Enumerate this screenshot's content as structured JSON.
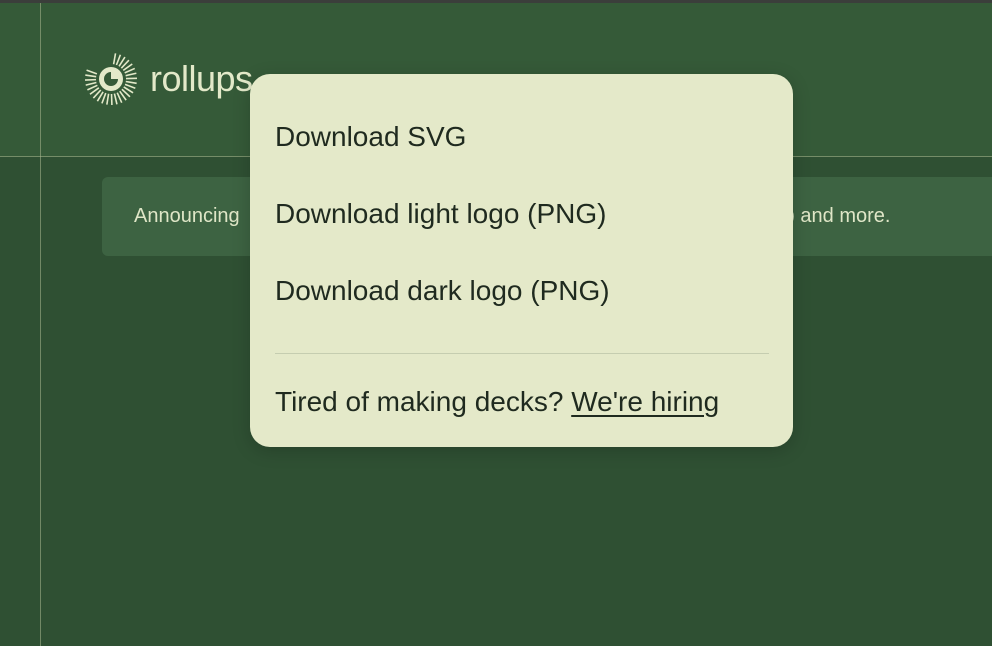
{
  "brand": {
    "name": "rollups",
    "icon": "sunburst-logo-icon"
  },
  "announcement": {
    "text_start": "Announcing",
    "text_end": "/s) and more."
  },
  "menu": {
    "items": [
      {
        "label": "Download SVG"
      },
      {
        "label": "Download light logo (PNG)"
      },
      {
        "label": "Download dark logo (PNG)"
      }
    ],
    "footer_text": "Tired of making decks?",
    "footer_link": "We're hiring"
  },
  "colors": {
    "background": "#2f5033",
    "header": "#355a38",
    "menu_bg": "#e4e9c9",
    "logo": "#e3e9c9",
    "text_dark": "#1f2a1f"
  }
}
